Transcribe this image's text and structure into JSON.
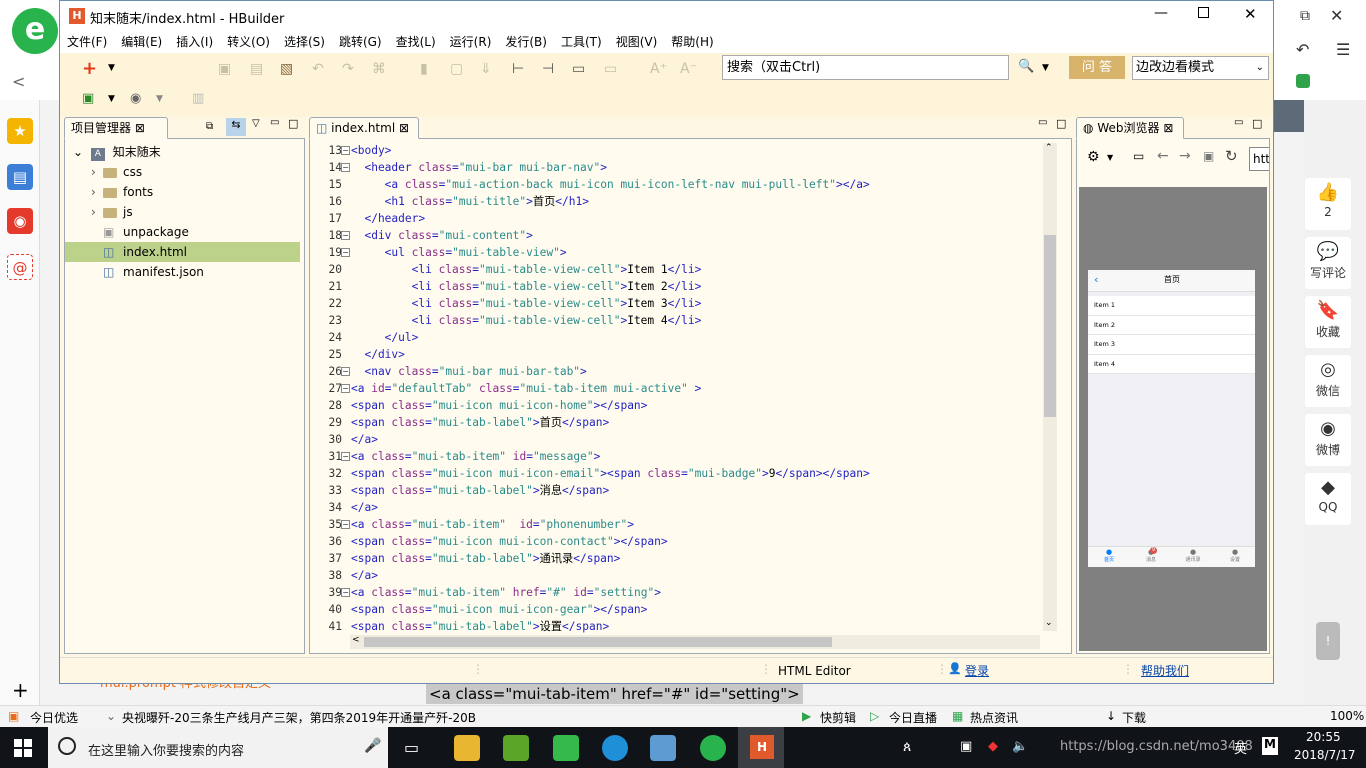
{
  "window": {
    "title": "知末随末/index.html  -  HBuilder",
    "icon_label": "H"
  },
  "menu": [
    "文件(F)",
    "编辑(E)",
    "插入(I)",
    "转义(O)",
    "选择(S)",
    "跳转(G)",
    "查找(L)",
    "运行(R)",
    "发行(B)",
    "工具(T)",
    "视图(V)",
    "帮助(H)"
  ],
  "toolbar": {
    "search_placeholder": "搜索（双击Ctrl)",
    "ask_label": "问 答",
    "mode_select": "边改边看模式"
  },
  "project_pane": {
    "tab": "项目管理器",
    "root": "知末随末",
    "items": [
      {
        "label": "css",
        "type": "folder"
      },
      {
        "label": "fonts",
        "type": "folder"
      },
      {
        "label": "js",
        "type": "folder"
      },
      {
        "label": "unpackage",
        "type": "package"
      },
      {
        "label": "index.html",
        "type": "file",
        "selected": true
      },
      {
        "label": "manifest.json",
        "type": "file"
      }
    ]
  },
  "editor": {
    "tab": "index.html",
    "lines": [
      {
        "n": "13",
        "fold": true,
        "code": [
          [
            "tag",
            "<body>"
          ]
        ]
      },
      {
        "n": "14",
        "fold": true,
        "code": [
          [
            "tag",
            "  <header "
          ],
          [
            "attr",
            "class"
          ],
          [
            "tag",
            "="
          ],
          [
            "val",
            "\"mui-bar mui-bar-nav\""
          ],
          [
            "tag",
            ">"
          ]
        ]
      },
      {
        "n": "15",
        "code": [
          [
            "tag",
            "     <a "
          ],
          [
            "attr",
            "class"
          ],
          [
            "tag",
            "="
          ],
          [
            "val",
            "\"mui-action-back mui-icon mui-icon-left-nav mui-pull-left\""
          ],
          [
            "tag",
            "></a>"
          ]
        ]
      },
      {
        "n": "16",
        "code": [
          [
            "tag",
            "     <h1 "
          ],
          [
            "attr",
            "class"
          ],
          [
            "tag",
            "="
          ],
          [
            "val",
            "\"mui-title\""
          ],
          [
            "tag",
            ">"
          ],
          [
            "txt",
            "首页"
          ],
          [
            "tag",
            "</h1>"
          ]
        ]
      },
      {
        "n": "17",
        "code": [
          [
            "tag",
            "  </header>"
          ]
        ]
      },
      {
        "n": "18",
        "fold": true,
        "code": [
          [
            "tag",
            "  <div "
          ],
          [
            "attr",
            "class"
          ],
          [
            "tag",
            "="
          ],
          [
            "val",
            "\"mui-content\""
          ],
          [
            "tag",
            ">"
          ]
        ]
      },
      {
        "n": "19",
        "fold": true,
        "code": [
          [
            "tag",
            "     <ul "
          ],
          [
            "attr",
            "class"
          ],
          [
            "tag",
            "="
          ],
          [
            "val",
            "\"mui-table-view\""
          ],
          [
            "tag",
            ">"
          ]
        ]
      },
      {
        "n": "20",
        "code": [
          [
            "tag",
            "         <li "
          ],
          [
            "attr",
            "class"
          ],
          [
            "tag",
            "="
          ],
          [
            "val",
            "\"mui-table-view-cell\""
          ],
          [
            "tag",
            ">"
          ],
          [
            "txt",
            "Item 1"
          ],
          [
            "tag",
            "</li>"
          ]
        ]
      },
      {
        "n": "21",
        "code": [
          [
            "tag",
            "         <li "
          ],
          [
            "attr",
            "class"
          ],
          [
            "tag",
            "="
          ],
          [
            "val",
            "\"mui-table-view-cell\""
          ],
          [
            "tag",
            ">"
          ],
          [
            "txt",
            "Item 2"
          ],
          [
            "tag",
            "</li>"
          ]
        ]
      },
      {
        "n": "22",
        "code": [
          [
            "tag",
            "         <li "
          ],
          [
            "attr",
            "class"
          ],
          [
            "tag",
            "="
          ],
          [
            "val",
            "\"mui-table-view-cell\""
          ],
          [
            "tag",
            ">"
          ],
          [
            "txt",
            "Item 3"
          ],
          [
            "tag",
            "</li>"
          ]
        ]
      },
      {
        "n": "23",
        "code": [
          [
            "tag",
            "         <li "
          ],
          [
            "attr",
            "class"
          ],
          [
            "tag",
            "="
          ],
          [
            "val",
            "\"mui-table-view-cell\""
          ],
          [
            "tag",
            ">"
          ],
          [
            "txt",
            "Item 4"
          ],
          [
            "tag",
            "</li>"
          ]
        ]
      },
      {
        "n": "24",
        "code": [
          [
            "tag",
            "     </ul>"
          ]
        ]
      },
      {
        "n": "25",
        "code": [
          [
            "tag",
            "  </div>"
          ]
        ]
      },
      {
        "n": "26",
        "fold": true,
        "code": [
          [
            "tag",
            "  <nav "
          ],
          [
            "attr",
            "class"
          ],
          [
            "tag",
            "="
          ],
          [
            "val",
            "\"mui-bar mui-bar-tab\""
          ],
          [
            "tag",
            ">"
          ]
        ]
      },
      {
        "n": "27",
        "fold": true,
        "code": [
          [
            "tag",
            "<a "
          ],
          [
            "attr",
            "id"
          ],
          [
            "tag",
            "="
          ],
          [
            "val",
            "\"defaultTab\""
          ],
          [
            "tag",
            " "
          ],
          [
            "attr",
            "class"
          ],
          [
            "tag",
            "="
          ],
          [
            "val",
            "\"mui-tab-item mui-active\""
          ],
          [
            "tag",
            " >"
          ]
        ]
      },
      {
        "n": "28",
        "code": [
          [
            "tag",
            "<span "
          ],
          [
            "attr",
            "class"
          ],
          [
            "tag",
            "="
          ],
          [
            "val",
            "\"mui-icon mui-icon-home\""
          ],
          [
            "tag",
            "></span>"
          ]
        ]
      },
      {
        "n": "29",
        "code": [
          [
            "tag",
            "<span "
          ],
          [
            "attr",
            "class"
          ],
          [
            "tag",
            "="
          ],
          [
            "val",
            "\"mui-tab-label\""
          ],
          [
            "tag",
            ">"
          ],
          [
            "txt",
            "首页"
          ],
          [
            "tag",
            "</span>"
          ]
        ]
      },
      {
        "n": "30",
        "code": [
          [
            "tag",
            "</a>"
          ]
        ]
      },
      {
        "n": "31",
        "fold": true,
        "code": [
          [
            "tag",
            "<a "
          ],
          [
            "attr",
            "class"
          ],
          [
            "tag",
            "="
          ],
          [
            "val",
            "\"mui-tab-item\""
          ],
          [
            "tag",
            " "
          ],
          [
            "attr",
            "id"
          ],
          [
            "tag",
            "="
          ],
          [
            "val",
            "\"message\""
          ],
          [
            "tag",
            ">"
          ]
        ]
      },
      {
        "n": "32",
        "code": [
          [
            "tag",
            "<span "
          ],
          [
            "attr",
            "class"
          ],
          [
            "tag",
            "="
          ],
          [
            "val",
            "\"mui-icon mui-icon-email\""
          ],
          [
            "tag",
            "><span "
          ],
          [
            "attr",
            "class"
          ],
          [
            "tag",
            "="
          ],
          [
            "val",
            "\"mui-badge\""
          ],
          [
            "tag",
            ">"
          ],
          [
            "txt",
            "9"
          ],
          [
            "tag",
            "</span></span>"
          ]
        ]
      },
      {
        "n": "33",
        "code": [
          [
            "tag",
            "<span "
          ],
          [
            "attr",
            "class"
          ],
          [
            "tag",
            "="
          ],
          [
            "val",
            "\"mui-tab-label\""
          ],
          [
            "tag",
            ">"
          ],
          [
            "txt",
            "消息"
          ],
          [
            "tag",
            "</span>"
          ]
        ]
      },
      {
        "n": "34",
        "code": [
          [
            "tag",
            "</a>"
          ]
        ]
      },
      {
        "n": "35",
        "fold": true,
        "code": [
          [
            "tag",
            "<a "
          ],
          [
            "attr",
            "class"
          ],
          [
            "tag",
            "="
          ],
          [
            "val",
            "\"mui-tab-item\""
          ],
          [
            "tag",
            "  "
          ],
          [
            "attr",
            "id"
          ],
          [
            "tag",
            "="
          ],
          [
            "val",
            "\"phonenumber\""
          ],
          [
            "tag",
            ">"
          ]
        ]
      },
      {
        "n": "36",
        "code": [
          [
            "tag",
            "<span "
          ],
          [
            "attr",
            "class"
          ],
          [
            "tag",
            "="
          ],
          [
            "val",
            "\"mui-icon mui-icon-contact\""
          ],
          [
            "tag",
            "></span>"
          ]
        ]
      },
      {
        "n": "37",
        "code": [
          [
            "tag",
            "<span "
          ],
          [
            "attr",
            "class"
          ],
          [
            "tag",
            "="
          ],
          [
            "val",
            "\"mui-tab-label\""
          ],
          [
            "tag",
            ">"
          ],
          [
            "txt",
            "通讯录"
          ],
          [
            "tag",
            "</span>"
          ]
        ]
      },
      {
        "n": "38",
        "code": [
          [
            "tag",
            "</a>"
          ]
        ]
      },
      {
        "n": "39",
        "fold": true,
        "code": [
          [
            "tag",
            "<a "
          ],
          [
            "attr",
            "class"
          ],
          [
            "tag",
            "="
          ],
          [
            "val",
            "\"mui-tab-item\""
          ],
          [
            "tag",
            " "
          ],
          [
            "attr",
            "href"
          ],
          [
            "tag",
            "="
          ],
          [
            "val",
            "\"#\""
          ],
          [
            "tag",
            " "
          ],
          [
            "attr",
            "id"
          ],
          [
            "tag",
            "="
          ],
          [
            "val",
            "\"setting\""
          ],
          [
            "tag",
            ">"
          ]
        ]
      },
      {
        "n": "40",
        "code": [
          [
            "tag",
            "<span "
          ],
          [
            "attr",
            "class"
          ],
          [
            "tag",
            "="
          ],
          [
            "val",
            "\"mui-icon mui-icon-gear\""
          ],
          [
            "tag",
            "></span>"
          ]
        ]
      },
      {
        "n": "41",
        "code": [
          [
            "tag",
            "<span "
          ],
          [
            "attr",
            "class"
          ],
          [
            "tag",
            "="
          ],
          [
            "val",
            "\"mui-tab-label\""
          ],
          [
            "tag",
            ">"
          ],
          [
            "txt",
            "设置"
          ],
          [
            "tag",
            "</span>"
          ]
        ]
      }
    ]
  },
  "browser_pane": {
    "tab": "Web浏览器",
    "url": "htt",
    "preview": {
      "title": "首页",
      "items": [
        "Item 1",
        "Item 2",
        "Item 3",
        "Item 4"
      ],
      "tabs": [
        "首页",
        "消息",
        "通讯录",
        "设置"
      ],
      "badge": "9"
    }
  },
  "statusline": {
    "editor_type": "HTML Editor",
    "login": "登录",
    "help": "帮助我们"
  },
  "background": {
    "bottom_text": "mui.prompt 样式修改自定义",
    "tooltip": "<a class=\"mui-tab-item\" href=\"#\" id=\"setting\">",
    "right_panel": [
      {
        "icon": "👍",
        "label": "2"
      },
      {
        "icon": "💬",
        "label": "写评论"
      },
      {
        "icon": "🔖",
        "label": "收藏"
      },
      {
        "icon": "◎",
        "label": "微信"
      },
      {
        "icon": "◉",
        "label": "微博"
      },
      {
        "icon": "◆",
        "label": "QQ"
      }
    ]
  },
  "news_bar": {
    "left": "今日优选",
    "headline": "央视曝歼-20三条生产线月产三架，第四条2019年开通量产歼-20B",
    "items": [
      "快剪辑",
      "今日直播",
      "热点资讯",
      "下载"
    ],
    "zoom": "100%"
  },
  "taskbar": {
    "search_placeholder": "在这里输入你要搜索的内容",
    "time": "20:55",
    "date": "2018/7/17",
    "lang": "英",
    "url_watermark": "https://blog.csdn.net/mo3408"
  }
}
